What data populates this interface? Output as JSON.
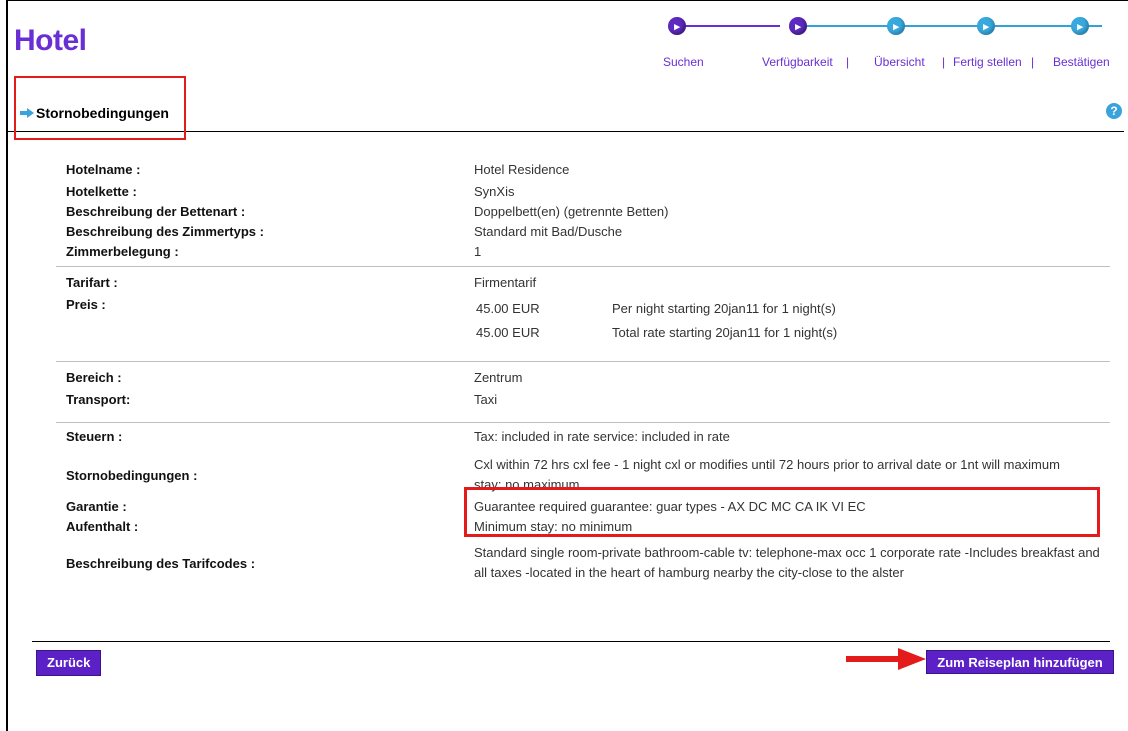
{
  "app": {
    "title": "Hotel"
  },
  "progress": {
    "steps": [
      {
        "label": "Suchen",
        "state": "done"
      },
      {
        "label": "Verfügbarkeit",
        "state": "done"
      },
      {
        "label": "Übersicht",
        "state": "todo"
      },
      {
        "label": "Fertig stellen",
        "state": "todo"
      },
      {
        "label": "Bestätigen",
        "state": "todo"
      }
    ],
    "separator": "|"
  },
  "section": {
    "title": "Stornobedingungen",
    "help_icon": "question-icon"
  },
  "details": {
    "hotel": [
      {
        "label": "Hotelname :",
        "value": "Hotel Residence"
      },
      {
        "label": "Hotelkette :",
        "value": "SynXis"
      },
      {
        "label": "Beschreibung der Bettenart :",
        "value": "Doppelbett(en) (getrennte Betten)"
      },
      {
        "label": "Beschreibung des Zimmertyps :",
        "value": "Standard mit Bad/Dusche"
      },
      {
        "label": "Zimmerbelegung :",
        "value": "1"
      }
    ],
    "rate": {
      "tarifart_label": "Tarifart :",
      "tarifart_value": "Firmentarif",
      "preis_label": "Preis :",
      "prices": [
        {
          "amount": "45.00 EUR",
          "desc": "Per night starting 20jan11 for 1 night(s)"
        },
        {
          "amount": "45.00 EUR",
          "desc": "Total rate starting 20jan11 for 1 night(s)"
        }
      ]
    },
    "location": [
      {
        "label": "Bereich :",
        "value": "Zentrum"
      },
      {
        "label": "Transport:",
        "value": "Taxi"
      }
    ],
    "policies": [
      {
        "label": "Steuern :",
        "value": "Tax: included in rate service: included in rate"
      },
      {
        "label": "Stornobedingungen :",
        "value": "Cxl within 72 hrs cxl fee - 1 night cxl or modifies until 72 hours prior to arrival date or 1nt will maximum stay: no maximum"
      },
      {
        "label": "Garantie :",
        "value": "Guarantee required guarantee: guar types - AX DC MC CA IK VI EC"
      },
      {
        "label": "Aufenthalt :",
        "value": "Minimum stay: no minimum"
      },
      {
        "label": "Beschreibung des Tarifcodes :",
        "value": "Standard single room-private bathroom-cable tv: telephone-max occ 1 corporate rate -Includes breakfast and all taxes -located in the heart of hamburg nearby the city-close to the alster"
      }
    ]
  },
  "buttons": {
    "back": "Zurück",
    "add": "Zum Reiseplan hinzufügen"
  },
  "colors": {
    "brand": "#6a2fd4",
    "button": "#5b21c6",
    "step_todo": "#38a9de",
    "highlight": "#e31b1b"
  }
}
